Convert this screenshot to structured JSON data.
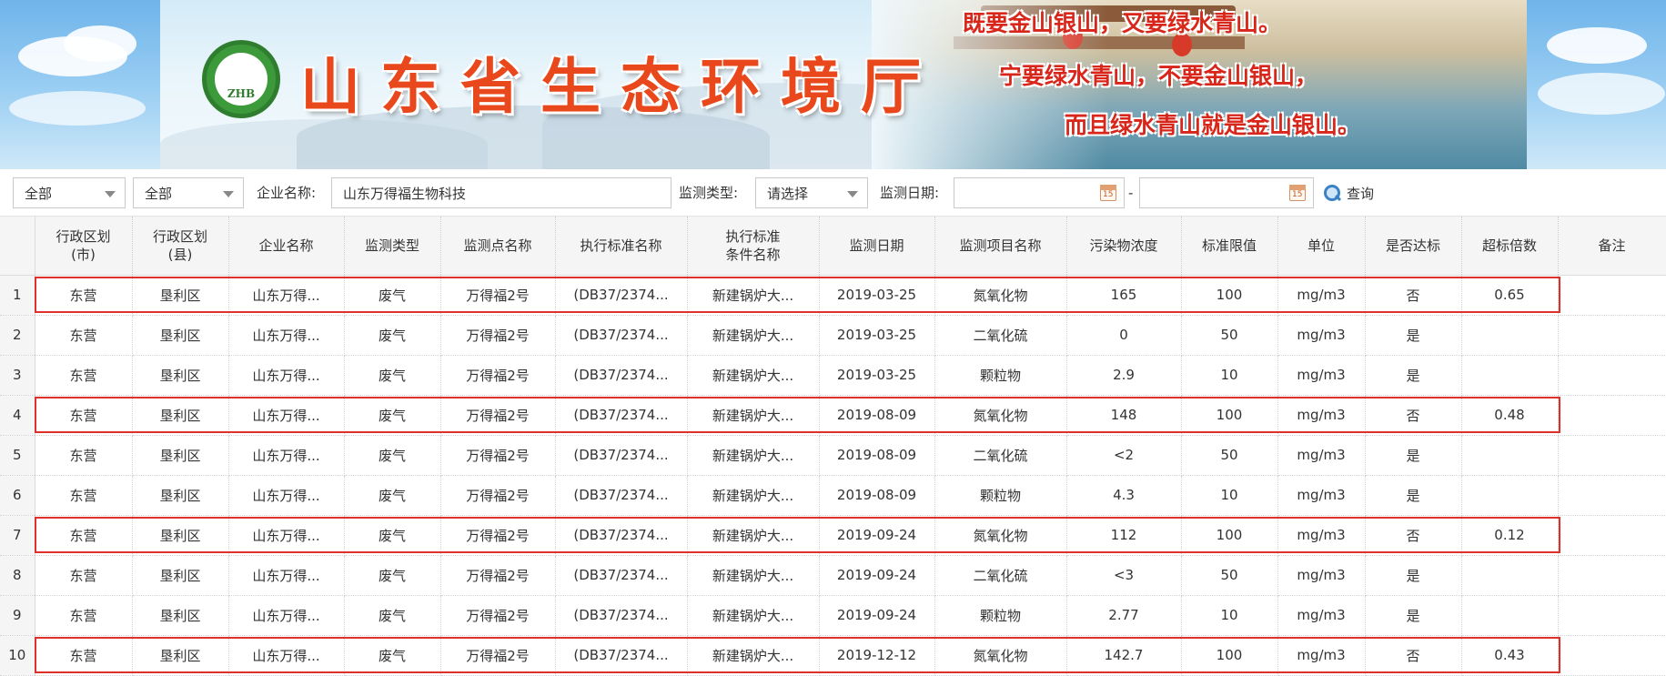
{
  "banner": {
    "logo_text": "ZHB",
    "title": "山东省生态环境厅",
    "slogans": [
      "既要金山银山，又要绿水青山。",
      "宁要绿水青山，不要金山银山，",
      "而且绿水青山就是金山银山。"
    ]
  },
  "filters": {
    "city_select": "全部",
    "county_select": "全部",
    "company_label": "企业名称:",
    "company_value": "山东万得福生物科技",
    "type_label": "监测类型:",
    "type_select": "请选择",
    "date_label": "监测日期:",
    "date_from": "",
    "date_sep": "-",
    "date_to": "",
    "search_label": "查询"
  },
  "table": {
    "columns": [
      {
        "line1": "行政区划",
        "line2": "(市)"
      },
      {
        "line1": "行政区划",
        "line2": "(县)"
      },
      {
        "line1": "企业名称",
        "line2": ""
      },
      {
        "line1": "监测类型",
        "line2": ""
      },
      {
        "line1": "监测点名称",
        "line2": ""
      },
      {
        "line1": "执行标准名称",
        "line2": ""
      },
      {
        "line1": "执行标准",
        "line2": "条件名称"
      },
      {
        "line1": "监测日期",
        "line2": ""
      },
      {
        "line1": "监测项目名称",
        "line2": ""
      },
      {
        "line1": "污染物浓度",
        "line2": ""
      },
      {
        "line1": "标准限值",
        "line2": ""
      },
      {
        "line1": "单位",
        "line2": ""
      },
      {
        "line1": "是否达标",
        "line2": ""
      },
      {
        "line1": "超标倍数",
        "line2": ""
      },
      {
        "line1": "备注",
        "line2": ""
      }
    ],
    "rows": [
      {
        "n": "1",
        "city": "东营",
        "county": "垦利区",
        "company": "山东万得...",
        "type": "废气",
        "point": "万得福2号",
        "std": "(DB37/2374...",
        "cond": "新建锅炉大...",
        "date": "2019-03-25",
        "item": "氮氧化物",
        "conc": "165",
        "limit": "100",
        "unit": "mg/m3",
        "ok": "否",
        "over": "0.65",
        "note": ""
      },
      {
        "n": "2",
        "city": "东营",
        "county": "垦利区",
        "company": "山东万得...",
        "type": "废气",
        "point": "万得福2号",
        "std": "(DB37/2374...",
        "cond": "新建锅炉大...",
        "date": "2019-03-25",
        "item": "二氧化硫",
        "conc": "0",
        "limit": "50",
        "unit": "mg/m3",
        "ok": "是",
        "over": "",
        "note": ""
      },
      {
        "n": "3",
        "city": "东营",
        "county": "垦利区",
        "company": "山东万得...",
        "type": "废气",
        "point": "万得福2号",
        "std": "(DB37/2374...",
        "cond": "新建锅炉大...",
        "date": "2019-03-25",
        "item": "颗粒物",
        "conc": "2.9",
        "limit": "10",
        "unit": "mg/m3",
        "ok": "是",
        "over": "",
        "note": ""
      },
      {
        "n": "4",
        "city": "东营",
        "county": "垦利区",
        "company": "山东万得...",
        "type": "废气",
        "point": "万得福2号",
        "std": "(DB37/2374...",
        "cond": "新建锅炉大...",
        "date": "2019-08-09",
        "item": "氮氧化物",
        "conc": "148",
        "limit": "100",
        "unit": "mg/m3",
        "ok": "否",
        "over": "0.48",
        "note": ""
      },
      {
        "n": "5",
        "city": "东营",
        "county": "垦利区",
        "company": "山东万得...",
        "type": "废气",
        "point": "万得福2号",
        "std": "(DB37/2374...",
        "cond": "新建锅炉大...",
        "date": "2019-08-09",
        "item": "二氧化硫",
        "conc": "<2",
        "limit": "50",
        "unit": "mg/m3",
        "ok": "是",
        "over": "",
        "note": ""
      },
      {
        "n": "6",
        "city": "东营",
        "county": "垦利区",
        "company": "山东万得...",
        "type": "废气",
        "point": "万得福2号",
        "std": "(DB37/2374...",
        "cond": "新建锅炉大...",
        "date": "2019-08-09",
        "item": "颗粒物",
        "conc": "4.3",
        "limit": "10",
        "unit": "mg/m3",
        "ok": "是",
        "over": "",
        "note": ""
      },
      {
        "n": "7",
        "city": "东营",
        "county": "垦利区",
        "company": "山东万得...",
        "type": "废气",
        "point": "万得福2号",
        "std": "(DB37/2374...",
        "cond": "新建锅炉大...",
        "date": "2019-09-24",
        "item": "氮氧化物",
        "conc": "112",
        "limit": "100",
        "unit": "mg/m3",
        "ok": "否",
        "over": "0.12",
        "note": ""
      },
      {
        "n": "8",
        "city": "东营",
        "county": "垦利区",
        "company": "山东万得...",
        "type": "废气",
        "point": "万得福2号",
        "std": "(DB37/2374...",
        "cond": "新建锅炉大...",
        "date": "2019-09-24",
        "item": "二氧化硫",
        "conc": "<3",
        "limit": "50",
        "unit": "mg/m3",
        "ok": "是",
        "over": "",
        "note": ""
      },
      {
        "n": "9",
        "city": "东营",
        "county": "垦利区",
        "company": "山东万得...",
        "type": "废气",
        "point": "万得福2号",
        "std": "(DB37/2374...",
        "cond": "新建锅炉大...",
        "date": "2019-09-24",
        "item": "颗粒物",
        "conc": "2.77",
        "limit": "10",
        "unit": "mg/m3",
        "ok": "是",
        "over": "",
        "note": ""
      },
      {
        "n": "10",
        "city": "东营",
        "county": "垦利区",
        "company": "山东万得...",
        "type": "废气",
        "point": "万得福2号",
        "std": "(DB37/2374...",
        "cond": "新建锅炉大...",
        "date": "2019-12-12",
        "item": "氮氧化物",
        "conc": "142.7",
        "limit": "100",
        "unit": "mg/m3",
        "ok": "否",
        "over": "0.43",
        "note": ""
      }
    ],
    "highlighted_rows": [
      "1",
      "4",
      "7",
      "10"
    ]
  },
  "colors": {
    "title_red": "#e8481b",
    "slogan_red": "#d8261a",
    "highlight_red": "#e0302a",
    "logo_green": "#3c9a3a"
  },
  "icons": {
    "search": "magnifier-icon",
    "date": "calendar-icon",
    "dropdown": "caret-down-icon",
    "logo": "zhb-emblem"
  }
}
